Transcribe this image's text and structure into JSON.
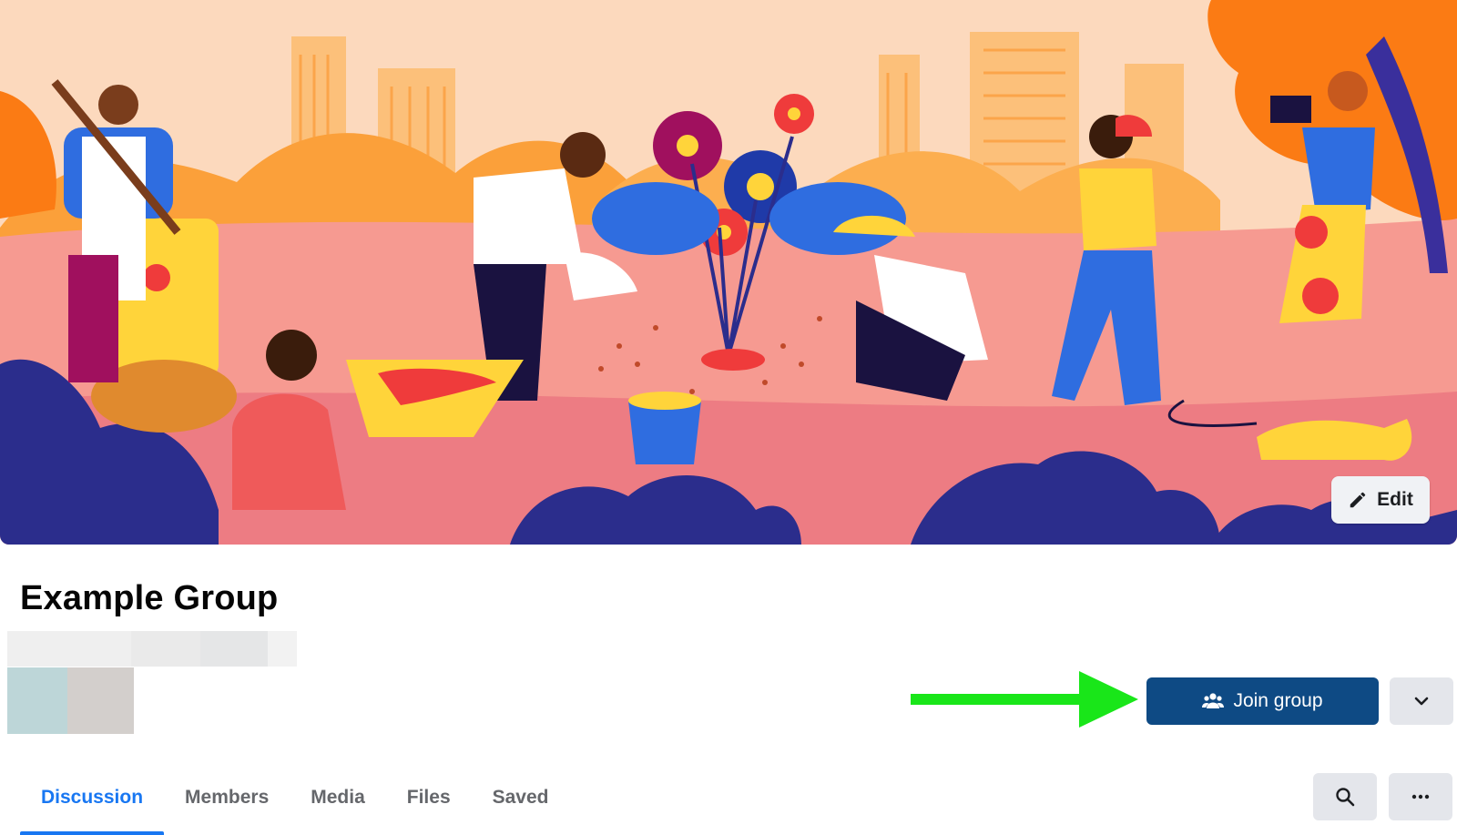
{
  "group": {
    "title": "Example Group"
  },
  "cover": {
    "edit_label": "Edit",
    "edit_icon": "pencil-icon",
    "colors": {
      "sky": "#fcd9bd",
      "ground": "#f49a8f",
      "buildings": "#fbb960",
      "bushes_dark": "#2b2d8c",
      "tree_orange": "#fb7b14"
    }
  },
  "actions": {
    "join_label": "Join group",
    "join_icon": "people-icon",
    "dropdown_icon": "chevron-down-icon",
    "annotation_arrow_color": "#19e619"
  },
  "tabs": [
    {
      "label": "Discussion",
      "active": true
    },
    {
      "label": "Members",
      "active": false
    },
    {
      "label": "Media",
      "active": false
    },
    {
      "label": "Files",
      "active": false
    },
    {
      "label": "Saved",
      "active": false
    }
  ],
  "toolbar": {
    "search_icon": "search-icon",
    "more_icon": "more-dots-icon"
  },
  "colors": {
    "accent": "#1877f2",
    "join_button": "#0e4a84",
    "secondary_button": "#e4e6eb"
  }
}
